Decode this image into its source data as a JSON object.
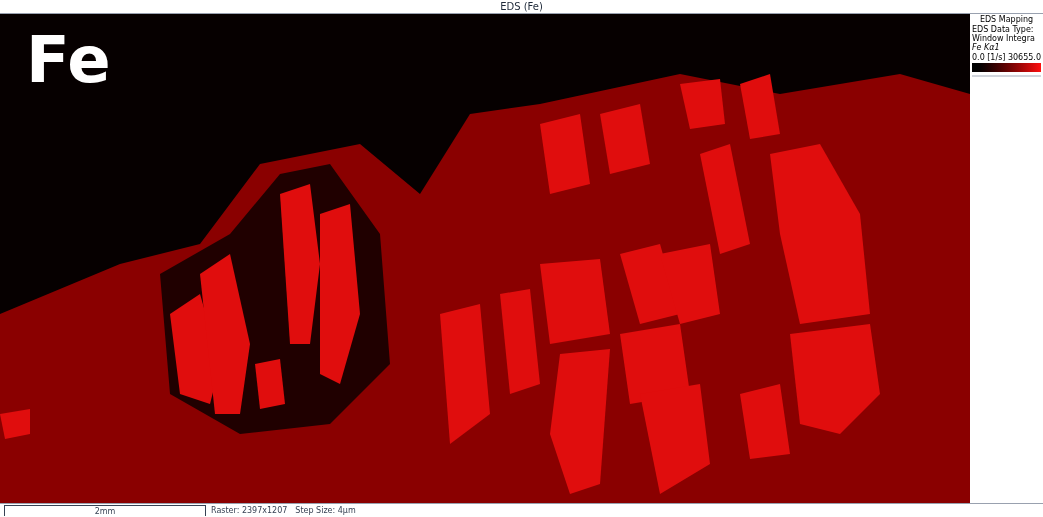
{
  "window": {
    "title": "EDS (Fe)"
  },
  "map": {
    "element_label": "Fe"
  },
  "legend": {
    "title": "EDS Mapping",
    "data_type": "EDS Data Type: Window Integra",
    "line": "Fe Kα1",
    "min": "0.0",
    "unit": "[1/s]",
    "max": "30655.0"
  },
  "status_bar": {
    "scale": "2mm",
    "raster": "Raster: 2397x1207",
    "step_size": "Step Size: 4µm"
  }
}
